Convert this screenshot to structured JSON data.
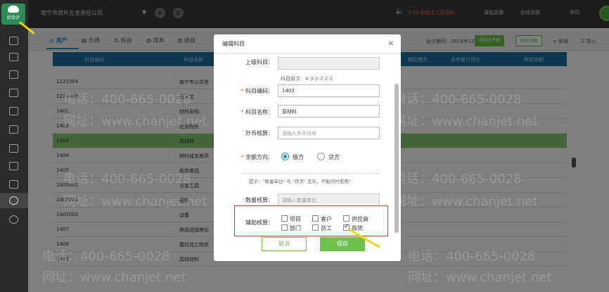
{
  "app": {
    "logo_label": "好会计",
    "company": "南宁市双升五金责任公司",
    "notice": "5.14 新版本上线通知",
    "top_links": [
      "课程直播",
      "在线客服",
      "李四"
    ]
  },
  "tabs": [
    {
      "label": "资产",
      "icon": "wallet-icon",
      "active": true
    },
    {
      "label": "负债",
      "icon": "list-icon",
      "active": false
    },
    {
      "label": "权益",
      "icon": "scale-icon",
      "active": false
    },
    {
      "label": "成本",
      "icon": "coin-icon",
      "active": false
    },
    {
      "label": "损益",
      "icon": "chart-icon",
      "active": false
    }
  ],
  "toolbar": {
    "period": "会计期间：2018年12月",
    "green_button": "初始化平衡",
    "outline_button": "期初余额",
    "add": "+ 新增",
    "import": "导入"
  },
  "table": {
    "headers": [
      "科目编码",
      "科目名称",
      "期初借方",
      "本年累计贷方",
      "年初余额"
    ],
    "rows": [
      {
        "code": "1221004",
        "name": "南宁市公共资"
      },
      {
        "code": "1221005",
        "name": "石又文"
      },
      {
        "code": "1401",
        "name": "材料采购"
      },
      {
        "code": "1402",
        "name": "在途物资"
      },
      {
        "code": "1403",
        "name": "原材料",
        "selected": true
      },
      {
        "code": "1404",
        "name": "材料成本差异"
      },
      {
        "code": "1405",
        "name": "库存商品"
      },
      {
        "code": "1405001",
        "name": "五金工具"
      },
      {
        "code": "1405002",
        "name": "配件"
      },
      {
        "code": "1405003",
        "name": "设备"
      },
      {
        "code": "1407",
        "name": "商品进销差价"
      },
      {
        "code": "1408",
        "name": "委托加工物资"
      },
      {
        "code": "1411",
        "name": "周转材料"
      }
    ]
  },
  "watermark": {
    "phone": "电话：400-665-0028",
    "url": "网址：www.chanjet.net"
  },
  "dialog": {
    "title": "编辑科目",
    "close": "×",
    "parent_label": "上级科目：",
    "parent_value": "",
    "level_hint": "科目级次：4-3-2-2-2-2",
    "code_label": "科目编码：",
    "code_value": "1403",
    "name_label": "科目名称：",
    "name_value": "原材料",
    "currency_label": "外币核算：",
    "currency_placeholder": "请输入外币符号",
    "direction_label": "余额方向：",
    "direction_debit": "借方",
    "direction_credit": "贷方",
    "direction_selected": "借方",
    "qty_hint": "提示：\"数量单位\" 与 \"存货\" 互斥，不能同时使用！",
    "qty_label": "数量核算：",
    "qty_placeholder": "请输入数量单位",
    "aux_label": "辅助核算：",
    "aux_options": [
      {
        "label": "项目",
        "checked": false
      },
      {
        "label": "客户",
        "checked": false
      },
      {
        "label": "供应商",
        "checked": false
      },
      {
        "label": "部门",
        "checked": false
      },
      {
        "label": "员工",
        "checked": false
      },
      {
        "label": "存货",
        "checked": true
      }
    ],
    "cancel": "取消",
    "save": "保存"
  },
  "colors": {
    "accent": "#1a8fc9",
    "green": "#6cc24a",
    "highlight_row": "#88c877",
    "arrow": "#f5d800",
    "box": "#c0392b"
  }
}
